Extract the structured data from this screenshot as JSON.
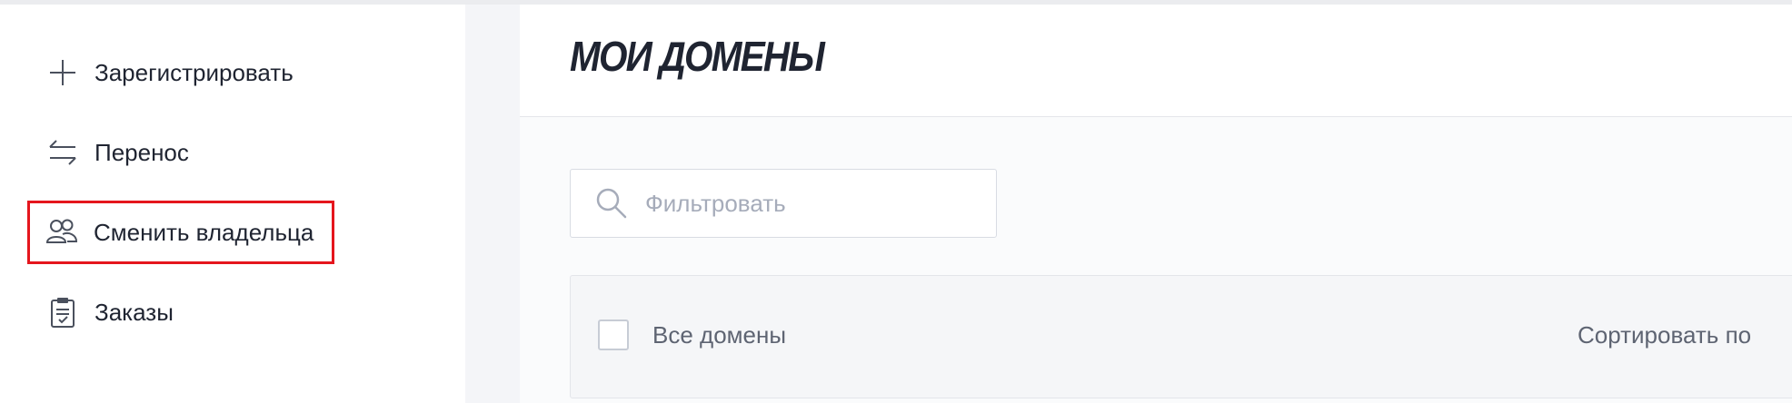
{
  "sidebar": {
    "items": [
      {
        "label": "Зарегистрировать",
        "icon": "plus-icon"
      },
      {
        "label": "Перенос",
        "icon": "transfer-arrows-icon"
      },
      {
        "label": "Сменить владельца",
        "icon": "users-icon",
        "highlighted": true,
        "highlight_color": "#e5161d"
      },
      {
        "label": "Заказы",
        "icon": "clipboard-icon"
      }
    ]
  },
  "header": {
    "title": "МОИ ДОМЕНЫ"
  },
  "filter": {
    "placeholder": "Фильтровать",
    "value": "",
    "icon": "search-icon"
  },
  "list": {
    "select_all_label": "Все домены",
    "select_all_checked": false,
    "sort_label": "Сортировать по"
  },
  "colors": {
    "text": "#1f2431",
    "muted": "#5e6472",
    "placeholder": "#a6acba",
    "highlight": "#e5161d"
  }
}
